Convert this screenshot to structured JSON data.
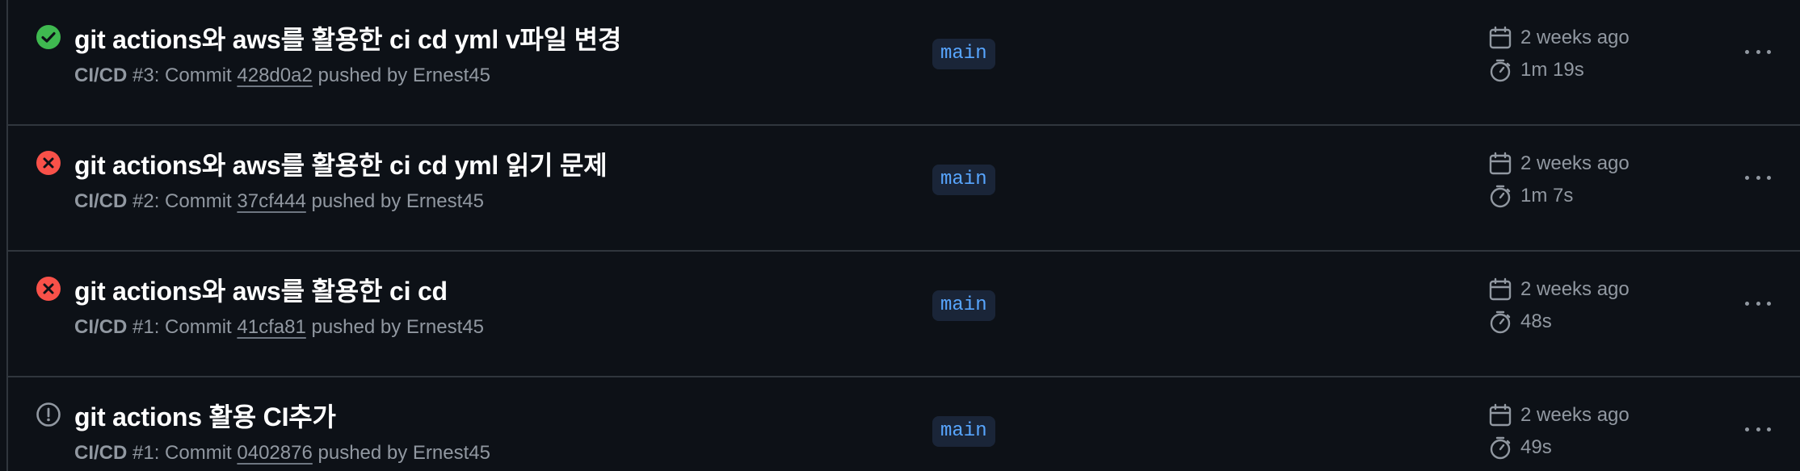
{
  "colors": {
    "background": "#0d1117",
    "border": "#30363d",
    "success": "#3fb950",
    "failure": "#f85149",
    "neutral": "#9198a1",
    "branch_text": "#58a6ff",
    "branch_bg": "#1a2538"
  },
  "runs": [
    {
      "status": "success",
      "status_icon": "check-circle-fill-icon",
      "title": "git actions와 aws를 활용한 ci cd yml v파일 변경",
      "workflow": "CI/CD",
      "run_number": "#3",
      "commit_prefix": ": Commit ",
      "commit_sha": "428d0a2",
      "pushed_by_text": " pushed by Ernest45",
      "branch": "main",
      "date": "2 weeks ago",
      "duration": "1m 19s"
    },
    {
      "status": "failure",
      "status_icon": "x-circle-fill-icon",
      "title": "git actions와 aws를 활용한 ci cd yml 읽기 문제",
      "workflow": "CI/CD",
      "run_number": "#2",
      "commit_prefix": ": Commit ",
      "commit_sha": "37cf444",
      "pushed_by_text": " pushed by Ernest45",
      "branch": "main",
      "date": "2 weeks ago",
      "duration": "1m 7s"
    },
    {
      "status": "failure",
      "status_icon": "x-circle-fill-icon",
      "title": "git actions와 aws를 활용한 ci cd",
      "workflow": "CI/CD",
      "run_number": "#1",
      "commit_prefix": ": Commit ",
      "commit_sha": "41cfa81",
      "pushed_by_text": " pushed by Ernest45",
      "branch": "main",
      "date": "2 weeks ago",
      "duration": "48s"
    },
    {
      "status": "startup_failure",
      "status_icon": "alert-circle-icon",
      "title": "git actions 활용 CI추가",
      "workflow": "CI/CD",
      "run_number": "#1",
      "commit_prefix": ": Commit ",
      "commit_sha": "0402876",
      "pushed_by_text": " pushed by Ernest45",
      "branch": "main",
      "date": "2 weeks ago",
      "duration": "49s"
    }
  ],
  "icons": {
    "date": "calendar-icon",
    "duration": "stopwatch-icon",
    "menu": "kebab-menu-icon"
  }
}
